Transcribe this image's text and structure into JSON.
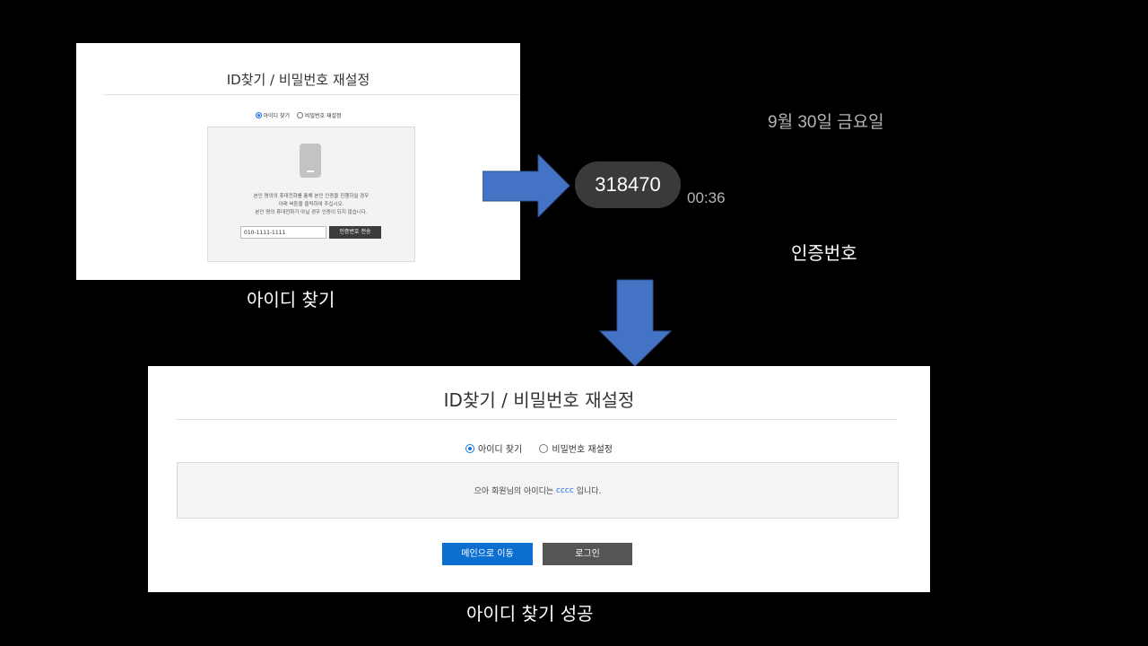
{
  "find_panel": {
    "title": "ID찾기 / 비밀번호 재설정",
    "radio_find_id": "아이디 찾기",
    "radio_reset_pw": "비밀번호 재설정",
    "message_line1": "본인 명의의 휴대전화를 통해 본인 인증을 진행하실 경우",
    "message_line2": "아래 버튼을 클릭하여 주십시오.",
    "message_line3": "본인 명의 휴대전화가 아닐 경우 인증이 되지 않습니다.",
    "phone_value": "010-1111-1111",
    "send_button": "인증번호 전송",
    "caption": "아이디 찾기"
  },
  "sms": {
    "date": "9월 30일 금요일",
    "code": "318470",
    "time": "00:36",
    "caption": "인증번호"
  },
  "result_panel": {
    "title": "ID찾기 / 비밀번호 재설정",
    "radio_find_id": "아이디 찾기",
    "radio_reset_pw": "비밀번호 재설정",
    "result_prefix": "으아 회원님의 아이디는",
    "result_id": "cccc",
    "result_suffix": "입니다.",
    "main_button": "메인으로 이동",
    "login_button": "로그인",
    "caption": "아이디 찾기 성공"
  },
  "colors": {
    "arrow": "#4472c4",
    "primary_button": "#0b6fd1",
    "background": "#000000"
  }
}
